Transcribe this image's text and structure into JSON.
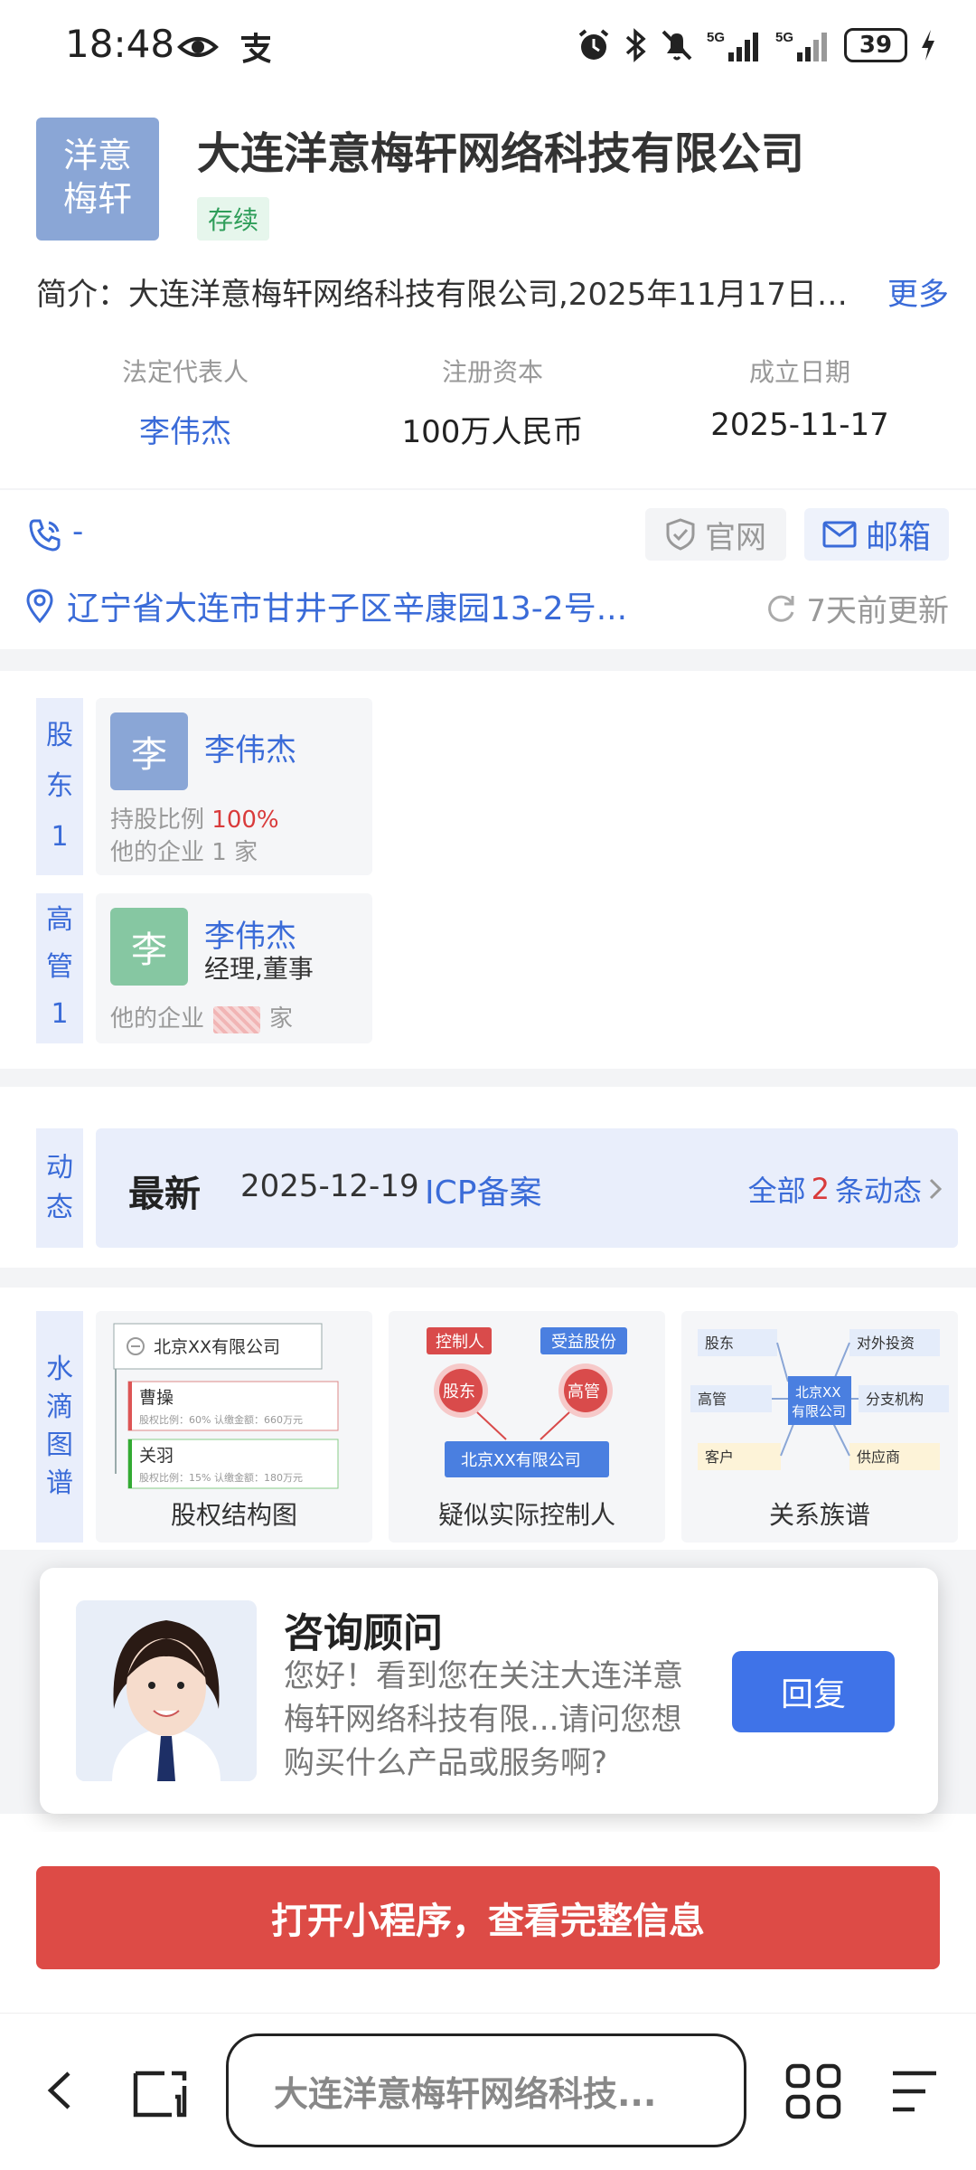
{
  "status_bar": {
    "time": "18:48",
    "left_icons": [
      "eye-icon",
      "alipay-icon"
    ],
    "right_icons": [
      "alarm-icon",
      "bluetooth-icon",
      "mute-icon",
      "5g-signal-icon",
      "5g-signal-icon"
    ],
    "battery": "39"
  },
  "company": {
    "logo_text_line1": "洋意",
    "logo_text_line2": "梅轩",
    "name": "大连洋意梅轩网络科技有限公司",
    "status": "存续",
    "intro_label": "简介：",
    "intro_text": "大连洋意梅轩网络科技有限公司,2025年11月17日…",
    "more": "更多",
    "facts": [
      {
        "label": "法定代表人",
        "value": "李伟杰"
      },
      {
        "label": "注册资本",
        "value": "100万人民币"
      },
      {
        "label": "成立日期",
        "value": "2025-11-17"
      }
    ]
  },
  "contact": {
    "phone": "-",
    "website": "官网",
    "email": "邮箱",
    "address": "辽宁省大连市甘井子区辛康园13-2号...",
    "updated": "7天前更新"
  },
  "shareholders": {
    "label_chars": [
      "股",
      "东",
      "1"
    ],
    "avatar": "李",
    "name": "李伟杰",
    "ratio_label": "持股比例",
    "ratio": "100%",
    "other_label": "他的企业",
    "other_count": "1",
    "other_unit": "家"
  },
  "executives": {
    "label_chars": [
      "高",
      "管",
      "1"
    ],
    "avatar": "李",
    "name": "李伟杰",
    "role": "经理,董事",
    "other_label": "他的企业",
    "other_unit": "家"
  },
  "news": {
    "label_chars": [
      "动",
      "态"
    ],
    "latest": "最新",
    "date": "2025-12-19",
    "type": "ICP备案",
    "all_prefix": "全部",
    "all_count": "2",
    "all_suffix": "条动态"
  },
  "graphs": {
    "label_chars": [
      "水",
      "滴",
      "图",
      "谱"
    ],
    "equity": {
      "caption": "股权结构图",
      "company": "北京XX有限公司",
      "p1": "曹操",
      "p1_detail": "股权比例：60%  认缴金额：660万元",
      "p2": "关羽",
      "p2_detail": "股权比例：15%  认缴金额：180万元"
    },
    "controller": {
      "caption": "疑似实际控制人",
      "tag1": "控制人",
      "tag2": "受益股份",
      "node1": "股东",
      "node2": "高管",
      "company": "北京XX有限公司"
    },
    "relation": {
      "caption": "关系族谱",
      "center1": "北京XX",
      "center2": "有限公司",
      "n1": "股东",
      "n2": "对外投资",
      "n3": "高管",
      "n4": "分支机构",
      "n5": "客户",
      "n6": "供应商"
    }
  },
  "consult": {
    "title": "咨询顾问",
    "message": "您好！看到您在关注大连洋意梅轩网络科技有限...请问您想购买什么产品或服务啊?",
    "reply": "回复"
  },
  "cta": "打开小程序，查看完整信息",
  "browser": {
    "url": "大连洋意梅轩网络科技..."
  },
  "colors": {
    "accent": "#3a6bd8",
    "cta": "#dd4b46",
    "status_green": "#2f9e5a"
  }
}
